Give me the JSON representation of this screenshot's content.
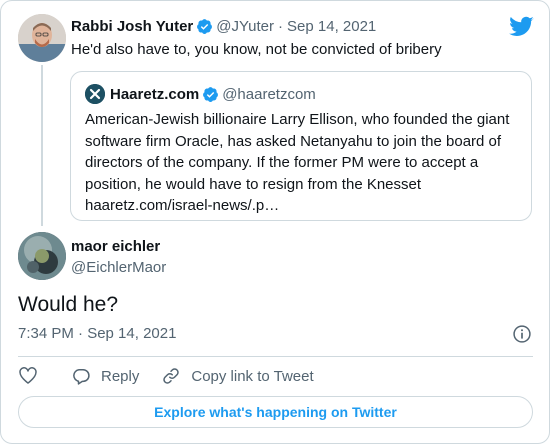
{
  "parent_tweet": {
    "author_name": "Rabbi Josh Yuter",
    "author_handle": "@JYuter",
    "separator": "·",
    "date": "Sep 14, 2021",
    "text": "He'd also have to, you know, not be convicted of bribery"
  },
  "quoted_tweet": {
    "author_name": "Haaretz.com",
    "author_handle": "@haaretzcom",
    "text_lines": [
      "American-Jewish billionaire Larry Ellison, who founded the giant",
      "software firm Oracle, has asked Netanyahu to join the board of",
      "directors of the company. If the former PM were to accept a",
      "position, he would have to resign from the Knesset",
      "haaretz.com/israel-news/.p…"
    ]
  },
  "reply_tweet": {
    "author_name": "maor eichler",
    "author_handle": "@EichlerMaor",
    "text": "Would he?",
    "timestamp": "7:34 PM · Sep 14, 2021"
  },
  "actions": {
    "reply_label": "Reply",
    "copy_link_label": "Copy link to Tweet"
  },
  "explore_label": "Explore what's happening on Twitter",
  "icons": {
    "brand": "twitter-bird-icon",
    "verified": "verified-badge-icon",
    "info": "info-icon",
    "like": "heart-icon",
    "reply": "speech-bubble-icon",
    "copy_link": "link-icon"
  },
  "colors": {
    "accent": "#1d9bf0",
    "text": "#0f1419",
    "muted": "#536471",
    "border": "#cfd9de"
  }
}
